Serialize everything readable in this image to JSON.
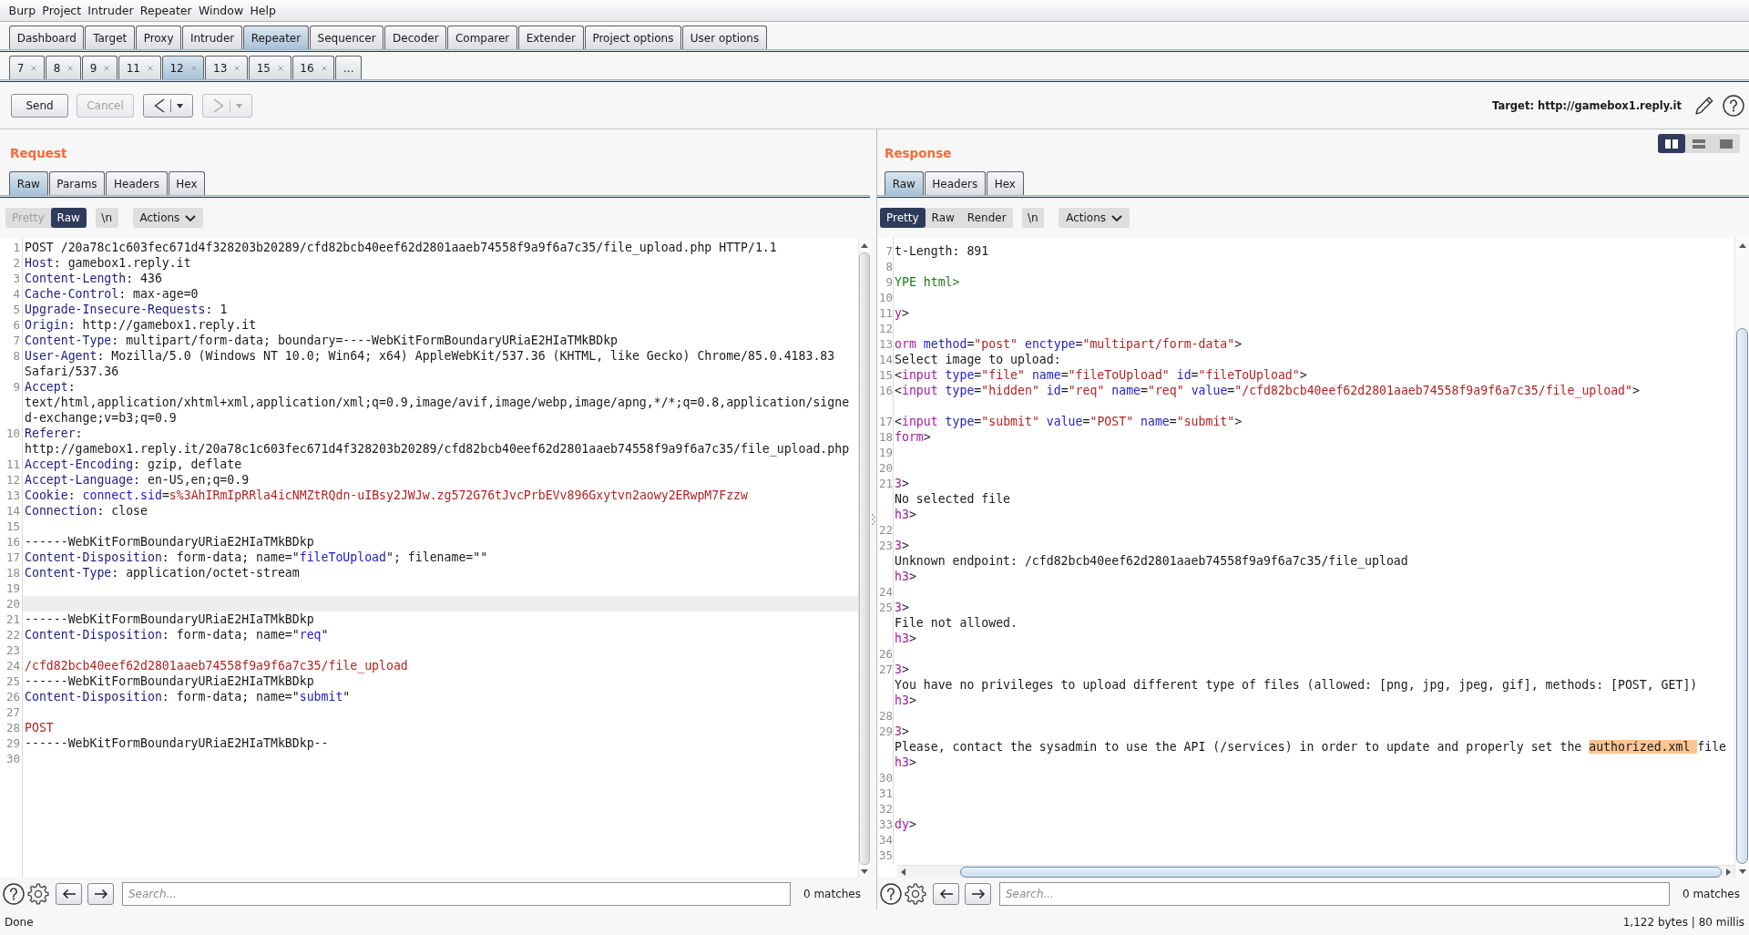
{
  "menu_bar": [
    "Burp",
    "Project",
    "Intruder",
    "Repeater",
    "Window",
    "Help"
  ],
  "main_tabs": [
    {
      "label": "Dashboard",
      "selected": false
    },
    {
      "label": "Target",
      "selected": false
    },
    {
      "label": "Proxy",
      "selected": false
    },
    {
      "label": "Intruder",
      "selected": false
    },
    {
      "label": "Repeater",
      "selected": true
    },
    {
      "label": "Sequencer",
      "selected": false
    },
    {
      "label": "Decoder",
      "selected": false
    },
    {
      "label": "Comparer",
      "selected": false
    },
    {
      "label": "Extender",
      "selected": false
    },
    {
      "label": "Project options",
      "selected": false
    },
    {
      "label": "User options",
      "selected": false
    }
  ],
  "repeater_tabs": [
    {
      "label": "7",
      "selected": false,
      "closable": true
    },
    {
      "label": "8",
      "selected": false,
      "closable": true
    },
    {
      "label": "9",
      "selected": false,
      "closable": true
    },
    {
      "label": "11",
      "selected": false,
      "closable": true
    },
    {
      "label": "12",
      "selected": true,
      "closable": true
    },
    {
      "label": "13",
      "selected": false,
      "closable": true
    },
    {
      "label": "15",
      "selected": false,
      "closable": true
    },
    {
      "label": "16",
      "selected": false,
      "closable": true
    },
    {
      "label": "...",
      "selected": false,
      "closable": false
    }
  ],
  "toolbar": {
    "buttons": [
      {
        "label": "Send",
        "disabled": false
      },
      {
        "label": "Cancel",
        "disabled": true
      }
    ],
    "history": [
      {
        "kind": "back",
        "disabled": false
      },
      {
        "kind": "forward",
        "disabled": true
      }
    ],
    "target": "Target: http://gamebox1.reply.it"
  },
  "layout_buttons": [
    {
      "kind": "columns",
      "selected": true
    },
    {
      "kind": "rows",
      "selected": false
    },
    {
      "kind": "single",
      "selected": false
    }
  ],
  "request": {
    "title": "Request",
    "tabs": [
      {
        "label": "Raw",
        "selected": true
      },
      {
        "label": "Params",
        "selected": false
      },
      {
        "label": "Headers",
        "selected": false
      },
      {
        "label": "Hex",
        "selected": false
      }
    ],
    "view_buttons": [
      {
        "label": "Pretty",
        "selected": false,
        "disabled": true
      },
      {
        "label": "Raw",
        "selected": true,
        "disabled": false
      }
    ],
    "newline_button": "\\n",
    "actions_button": "Actions",
    "lines": [
      {
        "number": "1",
        "current": false,
        "rows": [
          {
            "parts": [
              {
                "kind": "plain",
                "text": "POST /20a78c1c603fec671d4f328203b20289/cfd82bcb40eef62d2801aaeb74558f9a9f6a7c35/file_upload.php HTTP/1.1"
              }
            ]
          }
        ]
      },
      {
        "number": "2",
        "current": false,
        "rows": [
          {
            "parts": [
              {
                "kind": "header",
                "text": "Host"
              },
              {
                "kind": "plain",
                "text": ": gamebox1.reply.it"
              }
            ]
          }
        ]
      },
      {
        "number": "3",
        "current": false,
        "rows": [
          {
            "parts": [
              {
                "kind": "header",
                "text": "Content-Length"
              },
              {
                "kind": "plain",
                "text": ": 436"
              }
            ]
          }
        ]
      },
      {
        "number": "4",
        "current": false,
        "rows": [
          {
            "parts": [
              {
                "kind": "header",
                "text": "Cache-Control"
              },
              {
                "kind": "plain",
                "text": ": max-age=0"
              }
            ]
          }
        ]
      },
      {
        "number": "5",
        "current": false,
        "rows": [
          {
            "parts": [
              {
                "kind": "header",
                "text": "Upgrade-Insecure-Requests"
              },
              {
                "kind": "plain",
                "text": ": 1"
              }
            ]
          }
        ]
      },
      {
        "number": "6",
        "current": false,
        "rows": [
          {
            "parts": [
              {
                "kind": "header",
                "text": "Origin"
              },
              {
                "kind": "plain",
                "text": ": http://gamebox1.reply.it"
              }
            ]
          }
        ]
      },
      {
        "number": "7",
        "current": false,
        "rows": [
          {
            "parts": [
              {
                "kind": "header",
                "text": "Content-Type"
              },
              {
                "kind": "plain",
                "text": ": multipart/form-data; boundary=----WebKitFormBoundaryURiaE2HIaTMkBDkp"
              }
            ]
          }
        ]
      },
      {
        "number": "8",
        "current": false,
        "rows": [
          {
            "parts": [
              {
                "kind": "header",
                "text": "User-Agent"
              },
              {
                "kind": "plain",
                "text": ": Mozilla/5.0 (Windows NT 10.0; Win64; x64) AppleWebKit/537.36 (KHTML, like Gecko) Chrome/85.0.4183.83"
              }
            ]
          },
          {
            "parts": [
              {
                "kind": "plain",
                "text": "Safari/537.36"
              }
            ]
          }
        ]
      },
      {
        "number": "9",
        "current": false,
        "rows": [
          {
            "parts": [
              {
                "kind": "header",
                "text": "Accept"
              },
              {
                "kind": "plain",
                "text": ":"
              }
            ]
          },
          {
            "parts": [
              {
                "kind": "plain",
                "text": "text/html,application/xhtml+xml,application/xml;q=0.9,image/avif,image/webp,image/apng,*/*;q=0.8,application/signe"
              }
            ]
          },
          {
            "parts": [
              {
                "kind": "plain",
                "text": "d-exchange;v=b3;q=0.9"
              }
            ]
          }
        ]
      },
      {
        "number": "10",
        "current": false,
        "rows": [
          {
            "parts": [
              {
                "kind": "header",
                "text": "Referer"
              },
              {
                "kind": "plain",
                "text": ":"
              }
            ]
          },
          {
            "parts": [
              {
                "kind": "plain",
                "text": "http://gamebox1.reply.it/20a78c1c603fec671d4f328203b20289/cfd82bcb40eef62d2801aaeb74558f9a9f6a7c35/file_upload.php"
              }
            ]
          }
        ]
      },
      {
        "number": "11",
        "current": false,
        "rows": [
          {
            "parts": [
              {
                "kind": "header",
                "text": "Accept-Encoding"
              },
              {
                "kind": "plain",
                "text": ": gzip, deflate"
              }
            ]
          }
        ]
      },
      {
        "number": "12",
        "current": false,
        "rows": [
          {
            "parts": [
              {
                "kind": "header",
                "text": "Accept-Language"
              },
              {
                "kind": "plain",
                "text": ": en-US,en;q=0.9"
              }
            ]
          }
        ]
      },
      {
        "number": "13",
        "current": false,
        "rows": [
          {
            "parts": [
              {
                "kind": "header",
                "text": "Cookie"
              },
              {
                "kind": "plain",
                "text": ": "
              },
              {
                "kind": "cookie_name",
                "text": "connect.sid"
              },
              {
                "kind": "plain",
                "text": "="
              },
              {
                "kind": "cookie_value",
                "text": "s%3AhIRmIpRRla4icNMZtRQdn-uIBsy2JWJw.zg572G76tJvcPrbEVv896Gxytvn2aowy2ERwpM7Fzzw"
              }
            ]
          }
        ]
      },
      {
        "number": "14",
        "current": false,
        "rows": [
          {
            "parts": [
              {
                "kind": "header",
                "text": "Connection"
              },
              {
                "kind": "plain",
                "text": ": close"
              }
            ]
          }
        ]
      },
      {
        "number": "15",
        "current": false
      },
      {
        "number": "16",
        "current": false,
        "rows": [
          {
            "parts": [
              {
                "kind": "plain",
                "text": "------WebKitFormBoundaryURiaE2HIaTMkBDkp"
              }
            ]
          }
        ]
      },
      {
        "number": "17",
        "current": false,
        "rows": [
          {
            "parts": [
              {
                "kind": "header",
                "text": "Content-Disposition"
              },
              {
                "kind": "plain",
                "text": ": form-data; name=\""
              },
              {
                "kind": "param",
                "text": "fileToUpload"
              },
              {
                "kind": "plain",
                "text": "\"; filename=\"\""
              }
            ]
          }
        ]
      },
      {
        "number": "18",
        "current": false,
        "rows": [
          {
            "parts": [
              {
                "kind": "header",
                "text": "Content-Type"
              },
              {
                "kind": "plain",
                "text": ": application/octet-stream"
              }
            ]
          }
        ]
      },
      {
        "number": "19",
        "current": false
      },
      {
        "number": "20",
        "current": true
      },
      {
        "number": "21",
        "current": false,
        "rows": [
          {
            "parts": [
              {
                "kind": "plain",
                "text": "------WebKitFormBoundaryURiaE2HIaTMkBDkp"
              }
            ]
          }
        ]
      },
      {
        "number": "22",
        "current": false,
        "rows": [
          {
            "parts": [
              {
                "kind": "header",
                "text": "Content-Disposition"
              },
              {
                "kind": "plain",
                "text": ": form-data; name=\""
              },
              {
                "kind": "param",
                "text": "req"
              },
              {
                "kind": "plain",
                "text": "\""
              }
            ]
          }
        ]
      },
      {
        "number": "23",
        "current": false
      },
      {
        "number": "24",
        "current": false,
        "rows": [
          {
            "parts": [
              {
                "kind": "body",
                "text": "/cfd82bcb40eef62d2801aaeb74558f9a9f6a7c35/file_upload"
              }
            ]
          }
        ]
      },
      {
        "number": "25",
        "current": false,
        "rows": [
          {
            "parts": [
              {
                "kind": "plain",
                "text": "------WebKitFormBoundaryURiaE2HIaTMkBDkp"
              }
            ]
          }
        ]
      },
      {
        "number": "26",
        "current": false,
        "rows": [
          {
            "parts": [
              {
                "kind": "header",
                "text": "Content-Disposition"
              },
              {
                "kind": "plain",
                "text": ": form-data; name=\""
              },
              {
                "kind": "param",
                "text": "submit"
              },
              {
                "kind": "plain",
                "text": "\""
              }
            ]
          }
        ]
      },
      {
        "number": "27",
        "current": false
      },
      {
        "number": "28",
        "current": false,
        "rows": [
          {
            "parts": [
              {
                "kind": "body",
                "text": "POST"
              }
            ]
          }
        ]
      },
      {
        "number": "29",
        "current": false,
        "rows": [
          {
            "parts": [
              {
                "kind": "plain",
                "text": "------WebKitFormBoundaryURiaE2HIaTMkBDkp--"
              }
            ]
          }
        ]
      },
      {
        "number": "30",
        "current": false
      }
    ],
    "search": {
      "placeholder": "Search...",
      "matches": "0 matches"
    }
  },
  "response": {
    "title": "Response",
    "tabs": [
      {
        "label": "Raw",
        "selected": true
      },
      {
        "label": "Headers",
        "selected": false
      },
      {
        "label": "Hex",
        "selected": false
      }
    ],
    "view_buttons": [
      {
        "label": "Pretty",
        "selected": true,
        "disabled": false
      },
      {
        "label": "Raw",
        "selected": false,
        "disabled": false
      },
      {
        "label": "Render",
        "selected": false,
        "disabled": false
      }
    ],
    "newline_button": "\\n",
    "actions_button": "Actions",
    "lines": [
      {
        "number": "7",
        "blank_continuation": false,
        "rows": [
          {
            "parts": [
              {
                "kind": "text",
                "text": "t-Length: 891"
              }
            ]
          }
        ]
      },
      {
        "number": "8",
        "blank_continuation": false
      },
      {
        "number": "9",
        "blank_continuation": false,
        "rows": [
          {
            "parts": [
              {
                "kind": "doctype",
                "text": "YPE html>"
              }
            ]
          }
        ]
      },
      {
        "number": "10",
        "blank_continuation": false
      },
      {
        "number": "11",
        "blank_continuation": false,
        "rows": [
          {
            "parts": [
              {
                "kind": "tag",
                "text": "y"
              },
              {
                "kind": "text",
                "text": ">"
              }
            ]
          }
        ]
      },
      {
        "number": "12",
        "blank_continuation": false
      },
      {
        "number": "13",
        "blank_continuation": false,
        "rows": [
          {
            "parts": [
              {
                "kind": "tag",
                "text": "orm"
              },
              {
                "kind": "attr",
                "text": " method"
              },
              {
                "kind": "text",
                "text": "="
              },
              {
                "kind": "value",
                "text": "\"post\""
              },
              {
                "kind": "attr",
                "text": " enctype"
              },
              {
                "kind": "text",
                "text": "="
              },
              {
                "kind": "value",
                "text": "\"multipart/form-data\""
              },
              {
                "kind": "text",
                "text": ">"
              }
            ]
          }
        ]
      },
      {
        "number": "14",
        "blank_continuation": false,
        "rows": [
          {
            "parts": [
              {
                "kind": "text",
                "text": "Select image to upload:"
              }
            ]
          }
        ]
      },
      {
        "number": "15",
        "blank_continuation": false,
        "rows": [
          {
            "parts": [
              {
                "kind": "text",
                "text": "<"
              },
              {
                "kind": "tag",
                "text": "input"
              },
              {
                "kind": "attr",
                "text": " type"
              },
              {
                "kind": "text",
                "text": "="
              },
              {
                "kind": "value",
                "text": "\"file\""
              },
              {
                "kind": "attr",
                "text": " name"
              },
              {
                "kind": "text",
                "text": "="
              },
              {
                "kind": "value",
                "text": "\"fileToUpload\""
              },
              {
                "kind": "attr",
                "text": " id"
              },
              {
                "kind": "text",
                "text": "="
              },
              {
                "kind": "value",
                "text": "\"fileToUpload\""
              },
              {
                "kind": "text",
                "text": ">"
              }
            ]
          }
        ]
      },
      {
        "number": "16",
        "blank_continuation": true,
        "rows": [
          {
            "parts": [
              {
                "kind": "text",
                "text": "<"
              },
              {
                "kind": "tag",
                "text": "input"
              },
              {
                "kind": "attr",
                "text": " type"
              },
              {
                "kind": "text",
                "text": "="
              },
              {
                "kind": "value",
                "text": "\"hidden\""
              },
              {
                "kind": "attr",
                "text": " id"
              },
              {
                "kind": "text",
                "text": "="
              },
              {
                "kind": "value",
                "text": "\"req\""
              },
              {
                "kind": "attr",
                "text": " name"
              },
              {
                "kind": "text",
                "text": "="
              },
              {
                "kind": "value",
                "text": "\"req\""
              },
              {
                "kind": "attr",
                "text": " value"
              },
              {
                "kind": "text",
                "text": "="
              },
              {
                "kind": "value",
                "text": "\"/cfd82bcb40eef62d2801aaeb74558f9a9f6a7c35/file_upload\""
              },
              {
                "kind": "text",
                "text": ">"
              }
            ]
          }
        ]
      },
      {
        "number": "17",
        "blank_continuation": false,
        "rows": [
          {
            "parts": [
              {
                "kind": "text",
                "text": "<"
              },
              {
                "kind": "tag",
                "text": "input"
              },
              {
                "kind": "attr",
                "text": " type"
              },
              {
                "kind": "text",
                "text": "="
              },
              {
                "kind": "value",
                "text": "\"submit\""
              },
              {
                "kind": "attr",
                "text": " value"
              },
              {
                "kind": "text",
                "text": "="
              },
              {
                "kind": "value",
                "text": "\"POST\""
              },
              {
                "kind": "attr",
                "text": " name"
              },
              {
                "kind": "text",
                "text": "="
              },
              {
                "kind": "value",
                "text": "\"submit\""
              },
              {
                "kind": "text",
                "text": ">"
              }
            ]
          }
        ]
      },
      {
        "number": "18",
        "blank_continuation": false,
        "rows": [
          {
            "parts": [
              {
                "kind": "tag",
                "text": "form"
              },
              {
                "kind": "text",
                "text": ">"
              }
            ]
          }
        ]
      },
      {
        "number": "19",
        "blank_continuation": false
      },
      {
        "number": "20",
        "blank_continuation": false
      },
      {
        "number": "21",
        "blank_continuation": false,
        "rows": [
          {
            "parts": [
              {
                "kind": "tag",
                "text": "3"
              },
              {
                "kind": "text",
                "text": ">"
              }
            ]
          },
          {
            "parts": [
              {
                "kind": "text",
                "text": "No selected file"
              }
            ]
          },
          {
            "parts": [
              {
                "kind": "tag",
                "text": "h3"
              },
              {
                "kind": "text",
                "text": ">"
              }
            ]
          }
        ]
      },
      {
        "number": "22",
        "blank_continuation": false
      },
      {
        "number": "23",
        "blank_continuation": false,
        "rows": [
          {
            "parts": [
              {
                "kind": "tag",
                "text": "3"
              },
              {
                "kind": "text",
                "text": ">"
              }
            ]
          },
          {
            "parts": [
              {
                "kind": "text",
                "text": "Unknown endpoint: /cfd82bcb40eef62d2801aaeb74558f9a9f6a7c35/file_upload"
              }
            ]
          },
          {
            "parts": [
              {
                "kind": "tag",
                "text": "h3"
              },
              {
                "kind": "text",
                "text": ">"
              }
            ]
          }
        ]
      },
      {
        "number": "24",
        "blank_continuation": false
      },
      {
        "number": "25",
        "blank_continuation": false,
        "rows": [
          {
            "parts": [
              {
                "kind": "tag",
                "text": "3"
              },
              {
                "kind": "text",
                "text": ">"
              }
            ]
          },
          {
            "parts": [
              {
                "kind": "text",
                "text": "File not allowed."
              }
            ]
          },
          {
            "parts": [
              {
                "kind": "tag",
                "text": "h3"
              },
              {
                "kind": "text",
                "text": ">"
              }
            ]
          }
        ]
      },
      {
        "number": "26",
        "blank_continuation": false
      },
      {
        "number": "27",
        "blank_continuation": false,
        "rows": [
          {
            "parts": [
              {
                "kind": "tag",
                "text": "3"
              },
              {
                "kind": "text",
                "text": ">"
              }
            ]
          },
          {
            "parts": [
              {
                "kind": "text",
                "text": "You have no privileges to upload different type of files (allowed: [png, jpg, jpeg, gif], methods: [POST, GET])"
              }
            ]
          },
          {
            "parts": [
              {
                "kind": "tag",
                "text": "h3"
              },
              {
                "kind": "text",
                "text": ">"
              }
            ]
          }
        ]
      },
      {
        "number": "28",
        "blank_continuation": false
      },
      {
        "number": "29",
        "blank_continuation": false,
        "rows": [
          {
            "parts": [
              {
                "kind": "tag",
                "text": "3"
              },
              {
                "kind": "text",
                "text": ">"
              }
            ]
          },
          {
            "parts": [
              {
                "kind": "text",
                "text": "Please, contact the sysadmin to use the API (/services) in order to update and properly set the "
              },
              {
                "kind": "highlight",
                "text": "authorized.xml "
              },
              {
                "kind": "text",
                "text": "file"
              }
            ]
          },
          {
            "parts": [
              {
                "kind": "tag",
                "text": "h3"
              },
              {
                "kind": "text",
                "text": ">"
              }
            ]
          }
        ]
      },
      {
        "number": "30",
        "blank_continuation": false
      },
      {
        "number": "31",
        "blank_continuation": false
      },
      {
        "number": "32",
        "blank_continuation": false
      },
      {
        "number": "33",
        "blank_continuation": false,
        "rows": [
          {
            "parts": [
              {
                "kind": "tag",
                "text": "dy"
              },
              {
                "kind": "text",
                "text": ">"
              }
            ]
          }
        ]
      },
      {
        "number": "34",
        "blank_continuation": false
      },
      {
        "number": "35",
        "blank_continuation": false
      }
    ],
    "search": {
      "placeholder": "Search...",
      "matches": "0 matches"
    }
  },
  "status_bar": {
    "message": "Done",
    "stats": "1,122 bytes | 80 millis"
  }
}
